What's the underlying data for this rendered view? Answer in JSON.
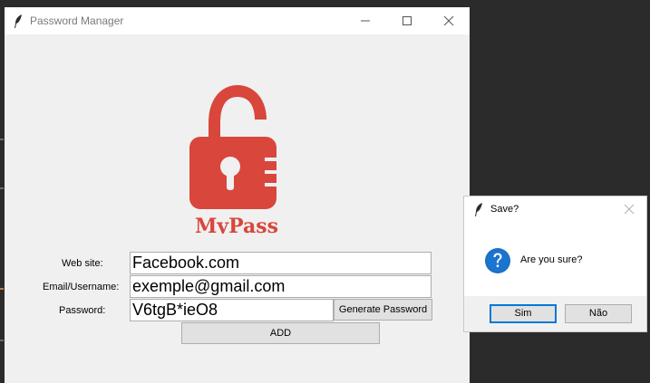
{
  "window": {
    "title": "Password Manager",
    "icon": "feather-icon"
  },
  "logo": {
    "text": "MyPass",
    "color": "#d9463c",
    "icon": "open-padlock-icon"
  },
  "form": {
    "website_label": "Web site:",
    "website_value": "Facebook.com",
    "email_label": "Email/Username:",
    "email_value": "exemple@gmail.com",
    "password_label": "Password:",
    "password_value": "V6tgB*ieO8",
    "generate_label": "Generate Password",
    "add_label": "ADD"
  },
  "dialog": {
    "title": "Save?",
    "message": "Are you sure?",
    "yes_label": "Sim",
    "no_label": "Não",
    "icon": "question-icon",
    "accent": "#0078d7"
  }
}
